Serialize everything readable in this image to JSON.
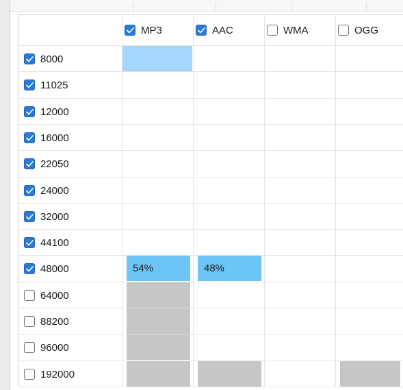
{
  "columns": [
    {
      "label": "MP3",
      "checked": true
    },
    {
      "label": "AAC",
      "checked": true
    },
    {
      "label": "WMA",
      "checked": false
    },
    {
      "label": "OGG",
      "checked": false
    }
  ],
  "rows": [
    {
      "label": "8000",
      "checked": true
    },
    {
      "label": "11025",
      "checked": true
    },
    {
      "label": "12000",
      "checked": true
    },
    {
      "label": "16000",
      "checked": true
    },
    {
      "label": "22050",
      "checked": true
    },
    {
      "label": "24000",
      "checked": true
    },
    {
      "label": "32000",
      "checked": true
    },
    {
      "label": "44100",
      "checked": true
    },
    {
      "label": "48000",
      "checked": true
    },
    {
      "label": "64000",
      "checked": false
    },
    {
      "label": "88200",
      "checked": false
    },
    {
      "label": "96000",
      "checked": false
    },
    {
      "label": "192000",
      "checked": false
    }
  ],
  "cells": [
    {
      "row": "8000",
      "column": "MP3",
      "state": "selected"
    },
    {
      "row": "48000",
      "column": "MP3",
      "state": "progress",
      "text": "54%",
      "progress": 0.54
    },
    {
      "row": "48000",
      "column": "AAC",
      "state": "progress",
      "text": "48%",
      "progress": 0.48
    },
    {
      "row": "64000",
      "column": "MP3",
      "state": "disabled"
    },
    {
      "row": "88200",
      "column": "MP3",
      "state": "disabled"
    },
    {
      "row": "96000",
      "column": "MP3",
      "state": "disabled"
    },
    {
      "row": "192000",
      "column": "MP3",
      "state": "disabled"
    },
    {
      "row": "192000",
      "column": "AAC",
      "state": "disabled"
    },
    {
      "row": "192000",
      "column": "OGG",
      "state": "disabled"
    }
  ],
  "colors": {
    "checkbox_checked": "#2b7bd6",
    "selected_cell": "#a5d5fb",
    "progress_cell": "#6cc5f7",
    "disabled_cell": "#c6c6c6",
    "gridline": "#e4e4e4"
  },
  "icons": {
    "checked": "checkbox-checked-icon",
    "unchecked": "checkbox-unchecked-icon"
  }
}
